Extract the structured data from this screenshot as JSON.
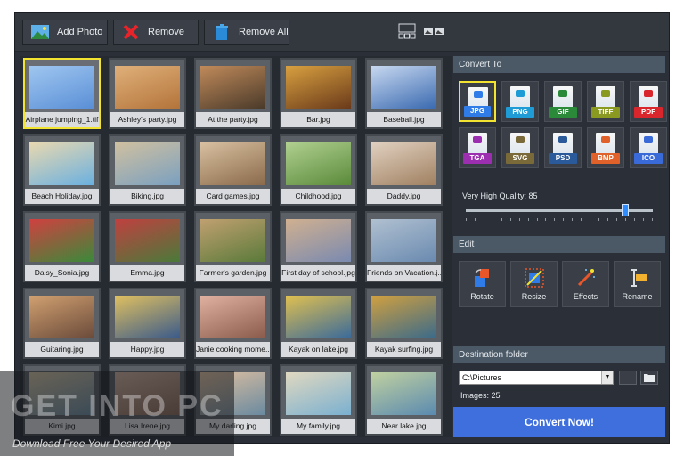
{
  "toolbar": {
    "add_photo": "Add Photo",
    "remove": "Remove",
    "remove_all": "Remove All"
  },
  "thumbnails": [
    {
      "caption": "Airplane jumping_1.tif",
      "selected": true
    },
    {
      "caption": "Ashley's party.jpg"
    },
    {
      "caption": "At the party.jpg"
    },
    {
      "caption": "Bar.jpg"
    },
    {
      "caption": "Baseball.jpg"
    },
    {
      "caption": "Beach Holiday.jpg"
    },
    {
      "caption": "Biking.jpg"
    },
    {
      "caption": "Card games.jpg"
    },
    {
      "caption": "Childhood.jpg"
    },
    {
      "caption": "Daddy.jpg"
    },
    {
      "caption": "Daisy_Sonia.jpg"
    },
    {
      "caption": "Emma.jpg"
    },
    {
      "caption": "Farmer's garden.jpg"
    },
    {
      "caption": "First day of school.jpg"
    },
    {
      "caption": "Friends on Vacation.j..."
    },
    {
      "caption": "Guitaring.jpg"
    },
    {
      "caption": "Happy.jpg"
    },
    {
      "caption": "Janie cooking mome..."
    },
    {
      "caption": "Kayak on lake.jpg"
    },
    {
      "caption": "Kayak surfing.jpg"
    },
    {
      "caption": "Kimi.jpg"
    },
    {
      "caption": "Lisa Irene.jpg"
    },
    {
      "caption": "My darling.jpg"
    },
    {
      "caption": "My family.jpg"
    },
    {
      "caption": "Near lake.jpg"
    }
  ],
  "convert_to": {
    "title": "Convert To",
    "formats": [
      {
        "label": "JPG",
        "color": "#2f7be8",
        "selected": true
      },
      {
        "label": "PNG",
        "color": "#1f9bd6"
      },
      {
        "label": "GIF",
        "color": "#2a8a3a"
      },
      {
        "label": "TIFF",
        "color": "#8a9a20"
      },
      {
        "label": "PDF",
        "color": "#d8262c"
      },
      {
        "label": "TGA",
        "color": "#9b2fb0"
      },
      {
        "label": "SVG",
        "color": "#7a6a3a"
      },
      {
        "label": "PSD",
        "color": "#2a5a9a"
      },
      {
        "label": "BMP",
        "color": "#e0622a"
      },
      {
        "label": "ICO",
        "color": "#3a6ad8"
      }
    ],
    "quality_label": "Very High Quality: 85",
    "quality_value": 85
  },
  "edit": {
    "title": "Edit",
    "buttons": [
      {
        "label": "Rotate"
      },
      {
        "label": "Resize"
      },
      {
        "label": "Effects"
      },
      {
        "label": "Rename"
      }
    ]
  },
  "destination": {
    "title": "Destination folder",
    "path": "C:\\Pictures",
    "browse_label": "...",
    "images_count": "Images: 25"
  },
  "convert_button": "Convert Now!",
  "watermark": {
    "logo": "GET INTO PC",
    "tagline": "Download Free Your Desired App"
  }
}
